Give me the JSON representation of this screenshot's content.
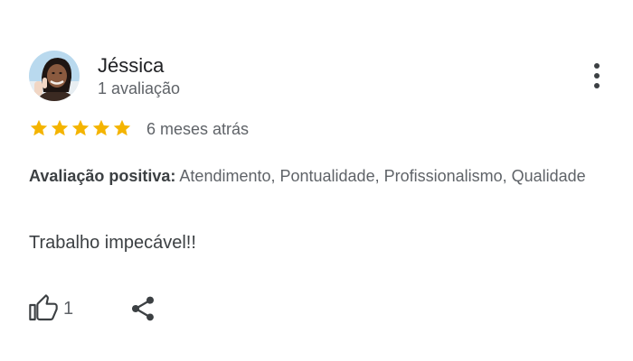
{
  "reviewer": {
    "name": "Jéssica",
    "review_count": "1 avaliação"
  },
  "review": {
    "rating": 5,
    "max_rating": 5,
    "time": "6 meses atrás",
    "positive_label": "Avaliação positiva:",
    "positive_items": "Atendimento, Pontualidade, Profissionalismo, Qualidade",
    "text": "Trabalho impecável!!",
    "likes": "1"
  },
  "colors": {
    "star": "#F4B400",
    "secondary_text": "#5f6368",
    "primary_text": "#202124"
  },
  "icons": {
    "menu": "more-vert-icon",
    "like": "thumb-up-outline-icon",
    "share": "share-icon"
  }
}
